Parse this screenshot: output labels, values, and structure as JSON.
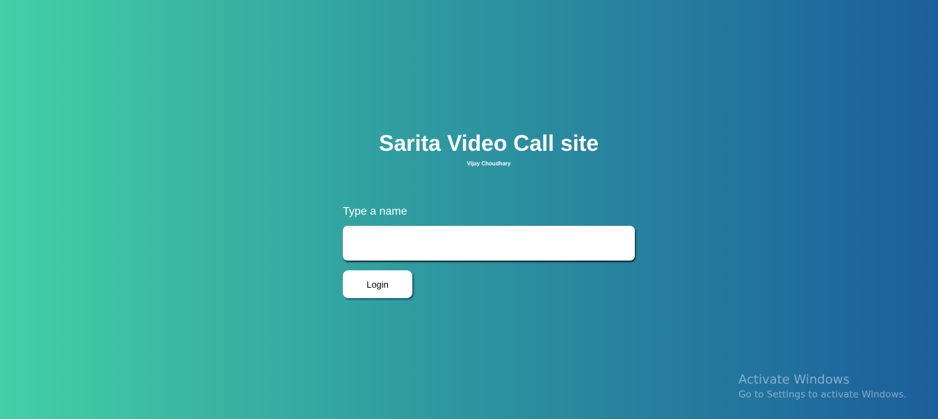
{
  "header": {
    "title": "Sarita Video Call site",
    "subtitle": "Vijay Choudhary"
  },
  "login_form": {
    "name_label": "Type a name",
    "name_value": "",
    "name_placeholder": "",
    "login_button_label": "Login"
  },
  "windows_watermark": {
    "title": "Activate Windows",
    "message": "Go to Settings to activate Windows."
  },
  "colors": {
    "gradient_start": "#43d0a5",
    "gradient_end": "#1b5e9c",
    "text": "#ffffff"
  }
}
